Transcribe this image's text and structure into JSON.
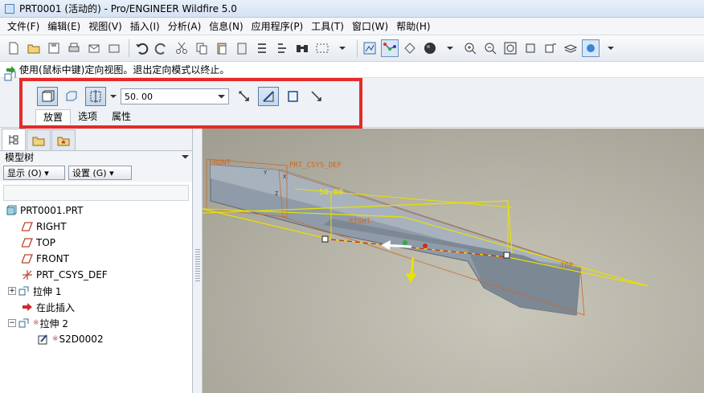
{
  "window": {
    "title": "PRT0001 (活动的) - Pro/ENGINEER Wildfire 5.0"
  },
  "menu": [
    "文件(F)",
    "编辑(E)",
    "视图(V)",
    "插入(I)",
    "分析(A)",
    "信息(N)",
    "应用程序(P)",
    "工具(T)",
    "窗口(W)",
    "帮助(H)"
  ],
  "message": {
    "text": "使用(鼠标中键)定向视图。退出定向模式以终止。"
  },
  "dashboard": {
    "depth_value": "50. 00",
    "tabs": [
      "放置",
      "选项",
      "属性"
    ]
  },
  "model_tree": {
    "header": "模型树",
    "show_button": "显示 (O) ▾",
    "settings_button": "设置 (G) ▾",
    "items": [
      {
        "label": "PRT0001.PRT"
      },
      {
        "label": "RIGHT"
      },
      {
        "label": "TOP"
      },
      {
        "label": "FRONT"
      },
      {
        "label": "PRT_CSYS_DEF"
      },
      {
        "label": "拉伸 1"
      },
      {
        "label": "在此插入"
      },
      {
        "label": "拉伸 2"
      },
      {
        "label": "S2D0002"
      }
    ]
  },
  "viewport": {
    "labels": {
      "front": "FRONT",
      "csys": "PRT_CSYS_DEF",
      "dim": "50.00",
      "right": "RIGHT",
      "top": "TOP",
      "x": "X",
      "y": "Y",
      "z": "Z"
    }
  },
  "colors": {
    "highlight": "#e52a2a",
    "datum": "#e8e200",
    "model": "#8f9ba8",
    "viewport_bg": "#b3b0a4"
  }
}
